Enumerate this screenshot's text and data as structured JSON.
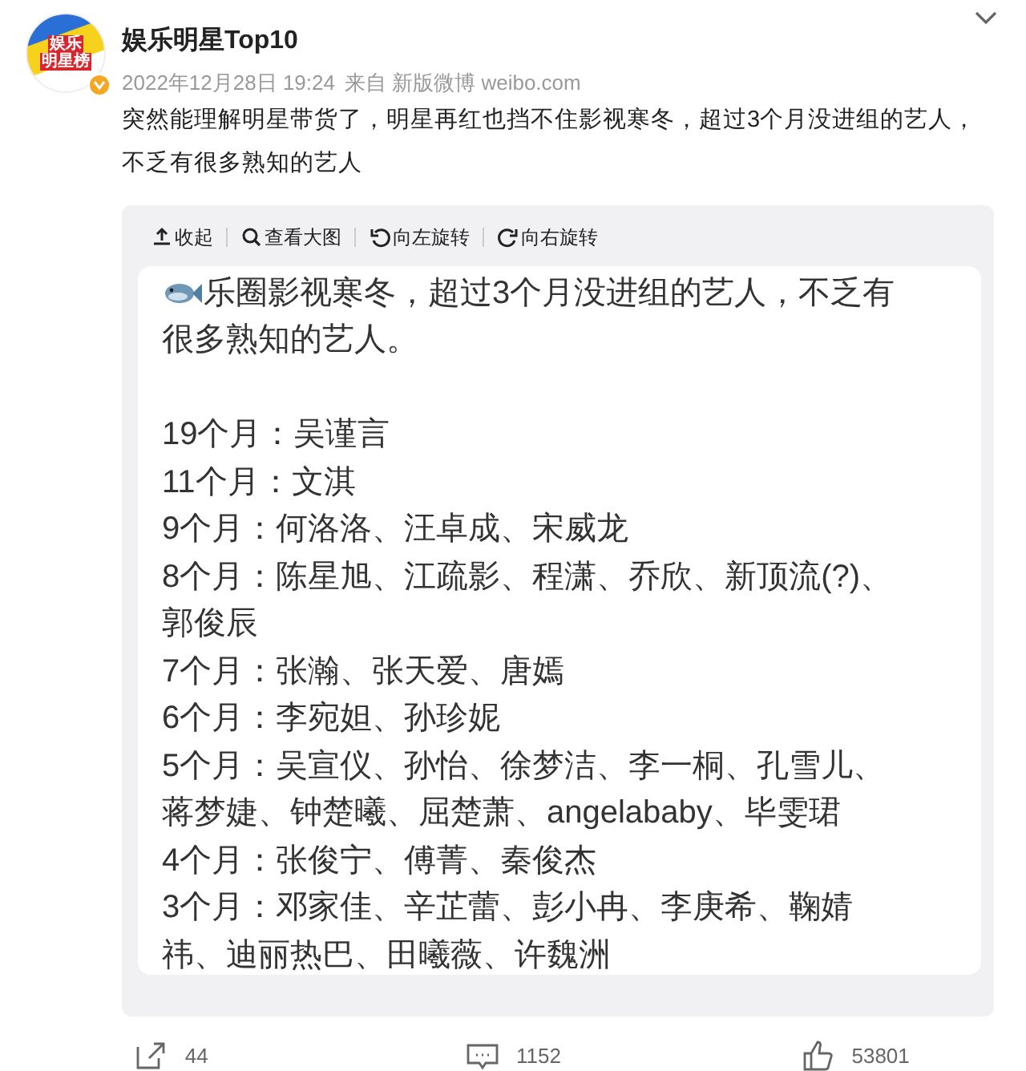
{
  "post": {
    "avatar_text": [
      "娱乐",
      "明星榜"
    ],
    "verified": true,
    "author": "娱乐明星Top10",
    "time": "2022年12月28日 19:24",
    "source": "来自 新版微博 weibo.com",
    "text": "突然能理解明星带货了，明星再红也挡不住影视寒冬，超过3个月没进组的艺人，不乏有很多熟知的艺人"
  },
  "image_viewer": {
    "toolbar": [
      {
        "kind": "collapse",
        "label": "收起"
      },
      {
        "kind": "zoom",
        "label": "查看大图"
      },
      {
        "kind": "rotate_left",
        "label": "向左旋转"
      },
      {
        "kind": "rotate_right",
        "label": "向右旋转"
      }
    ],
    "intro_lines": [
      "乐圈影视寒冬，超过3个月没进组的艺人，不乏有",
      "很多熟知的艺人。"
    ],
    "lines": [
      "19个月：吴谨言",
      "11个月：文淇",
      "9个月：何洛洛、汪卓成、宋威龙",
      "8个月：陈星旭、江疏影、程潇、乔欣、新顶流(?)、",
      "郭俊辰",
      "7个月：张瀚、张天爱、唐嫣",
      "6个月：李宛妲、孙珍妮",
      "5个月：吴宣仪、孙怡、徐梦洁、李一桐、孔雪儿、",
      "蒋梦婕、钟楚曦、屈楚萧、angelababy、毕雯珺",
      "4个月：张俊宁、傅菁、秦俊杰",
      "3个月：邓家佳、辛芷蕾、彭小冉、李庚希、鞠婧",
      "祎、迪丽热巴、田曦薇、许魏洲"
    ]
  },
  "actions": [
    {
      "kind": "repost",
      "count": "44"
    },
    {
      "kind": "comment",
      "count": "1152"
    },
    {
      "kind": "like",
      "count": "53801"
    }
  ]
}
